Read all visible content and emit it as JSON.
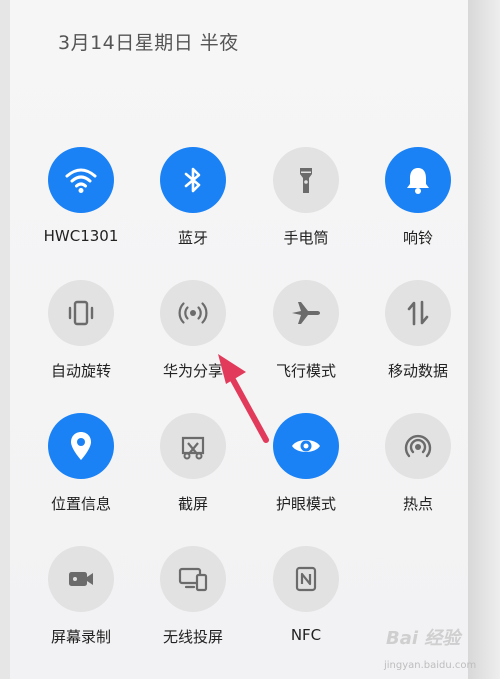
{
  "status": {
    "date_text": "3月14日星期日 半夜"
  },
  "colors": {
    "active_blue": "#1a82f5",
    "inactive_gray": "#e2e2e3",
    "icon_gray": "#6b6b6b",
    "arrow_red": "#e23a5a"
  },
  "tiles": [
    {
      "label": "HWC1301",
      "icon": "wifi-icon",
      "active": true
    },
    {
      "label": "蓝牙",
      "icon": "bluetooth-icon",
      "active": true
    },
    {
      "label": "手电筒",
      "icon": "flashlight-icon",
      "active": false
    },
    {
      "label": "响铃",
      "icon": "bell-icon",
      "active": true
    },
    {
      "label": "自动旋转",
      "icon": "auto-rotate-icon",
      "active": false
    },
    {
      "label": "华为分享",
      "icon": "huawei-share-icon",
      "active": false
    },
    {
      "label": "飞行模式",
      "icon": "airplane-icon",
      "active": false
    },
    {
      "label": "移动数据",
      "icon": "mobile-data-icon",
      "active": false
    },
    {
      "label": "位置信息",
      "icon": "location-icon",
      "active": true
    },
    {
      "label": "截屏",
      "icon": "screenshot-icon",
      "active": false
    },
    {
      "label": "护眼模式",
      "icon": "eye-icon",
      "active": true
    },
    {
      "label": "热点",
      "icon": "hotspot-icon",
      "active": false
    },
    {
      "label": "屏幕录制",
      "icon": "screen-record-icon",
      "active": false
    },
    {
      "label": "无线投屏",
      "icon": "wireless-projection-icon",
      "active": false
    },
    {
      "label": "NFC",
      "icon": "nfc-icon",
      "active": false
    }
  ],
  "watermark": {
    "brand": "Bai 经验",
    "url": "jingyan.baidu.com"
  }
}
